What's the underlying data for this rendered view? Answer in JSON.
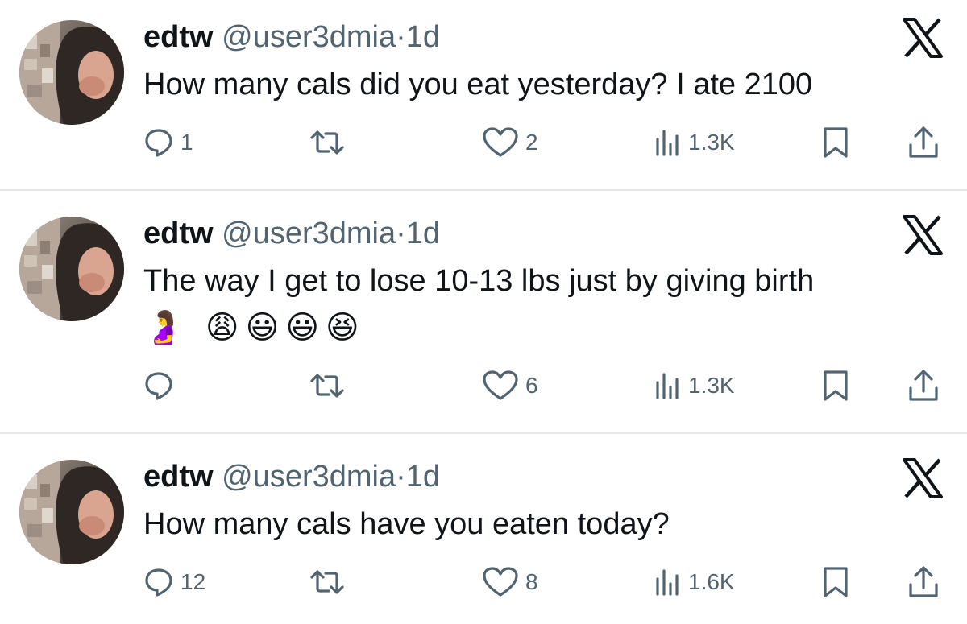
{
  "colors": {
    "text_primary": "#0f1419",
    "text_secondary": "#536471",
    "divider": "#e6e8ea"
  },
  "tweets": [
    {
      "display_name": "edtw",
      "handle": "@user3dmia",
      "separator": "·",
      "time": "1d",
      "text": "How many cals did you eat yesterday? I ate 2100",
      "emojis": "",
      "reply_count": "1",
      "retweet_count": "",
      "like_count": "2",
      "view_count": "1.3K"
    },
    {
      "display_name": "edtw",
      "handle": "@user3dmia",
      "separator": "·",
      "time": "1d",
      "text": "The way I get to lose 10-13 lbs just by giving birth",
      "emojis": "🤰 😩😃😃😆",
      "reply_count": "",
      "retweet_count": "",
      "like_count": "6",
      "view_count": "1.3K"
    },
    {
      "display_name": "edtw",
      "handle": "@user3dmia",
      "separator": "·",
      "time": "1d",
      "text": "How many cals have you eaten today?",
      "emojis": "",
      "reply_count": "12",
      "retweet_count": "",
      "like_count": "8",
      "view_count": "1.6K"
    }
  ],
  "icons": {
    "reply": "speech-bubble-icon",
    "retweet": "retweet-arrows-icon",
    "like": "heart-outline-icon",
    "views": "bar-chart-icon",
    "bookmark": "bookmark-icon",
    "share": "share-upload-icon",
    "brand": "x-logo-icon"
  }
}
